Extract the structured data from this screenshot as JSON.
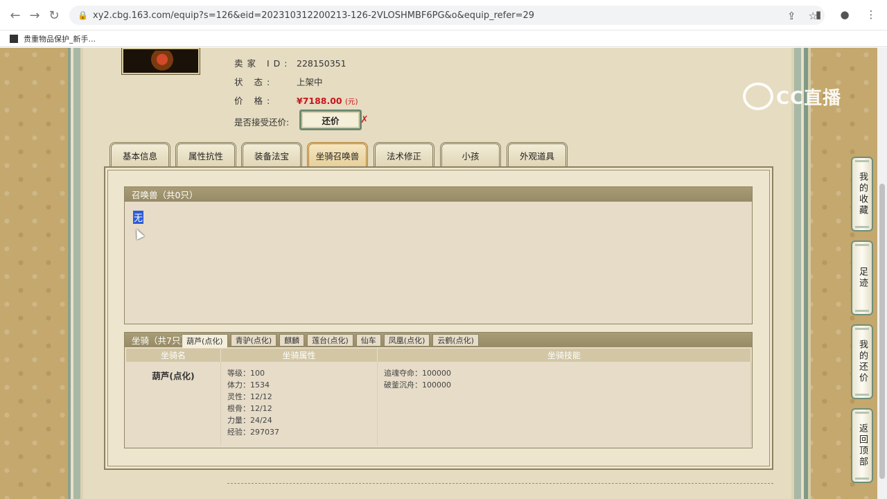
{
  "browser": {
    "url": "xy2.cbg.163.com/equip?s=126&eid=202310312200213-126-2VLOSHMBF6PG&o&equip_refer=29",
    "bookmark_label": "贵重物品保护_新手..."
  },
  "watermark": {
    "text": "CC直播"
  },
  "seller": {
    "id_label": "卖家 ID:",
    "id_value": "228150351",
    "status_label": "状 态:",
    "status_value": "上架中",
    "price_label": "价 格:",
    "price_value": "¥7188.00",
    "price_unit": "(元)",
    "bargain_label": "是否接受还价:",
    "bargain_button": "还价",
    "bargain_mark": "✗"
  },
  "tabs": [
    {
      "label": "基本信息",
      "active": false
    },
    {
      "label": "属性抗性",
      "active": false
    },
    {
      "label": "装备法宝",
      "active": false
    },
    {
      "label": "坐骑召唤兽",
      "active": true
    },
    {
      "label": "法术修正",
      "active": false
    },
    {
      "label": "小孩",
      "active": false
    },
    {
      "label": "外观道具",
      "active": false
    }
  ],
  "summon": {
    "title": "召唤兽（共0只）",
    "empty_text": "无"
  },
  "mounts": {
    "title": "坐骑（共7只）",
    "tabs": [
      {
        "label": "葫芦(点化)",
        "active": true
      },
      {
        "label": "青驴(点化)",
        "active": false
      },
      {
        "label": "麒麟",
        "active": false
      },
      {
        "label": "莲台(点化)",
        "active": false
      },
      {
        "label": "仙车",
        "active": false
      },
      {
        "label": "凤凰(点化)",
        "active": false
      },
      {
        "label": "云鹤(点化)",
        "active": false
      }
    ],
    "columns": [
      "坐骑名",
      "坐骑属性",
      "坐骑技能"
    ],
    "row": {
      "name": "葫芦(点化)",
      "attrs": [
        "等级：100",
        "体力：1534",
        "灵性：12/12",
        "根骨：12/12",
        "力量：24/24",
        "经验：297037"
      ],
      "skills": [
        "追魂夺命：100000",
        "破釜沉舟：100000"
      ]
    }
  },
  "sidebar": [
    {
      "label": "我的收藏"
    },
    {
      "label": "足迹"
    },
    {
      "label": "我的还价"
    },
    {
      "label": "返回顶部"
    }
  ]
}
